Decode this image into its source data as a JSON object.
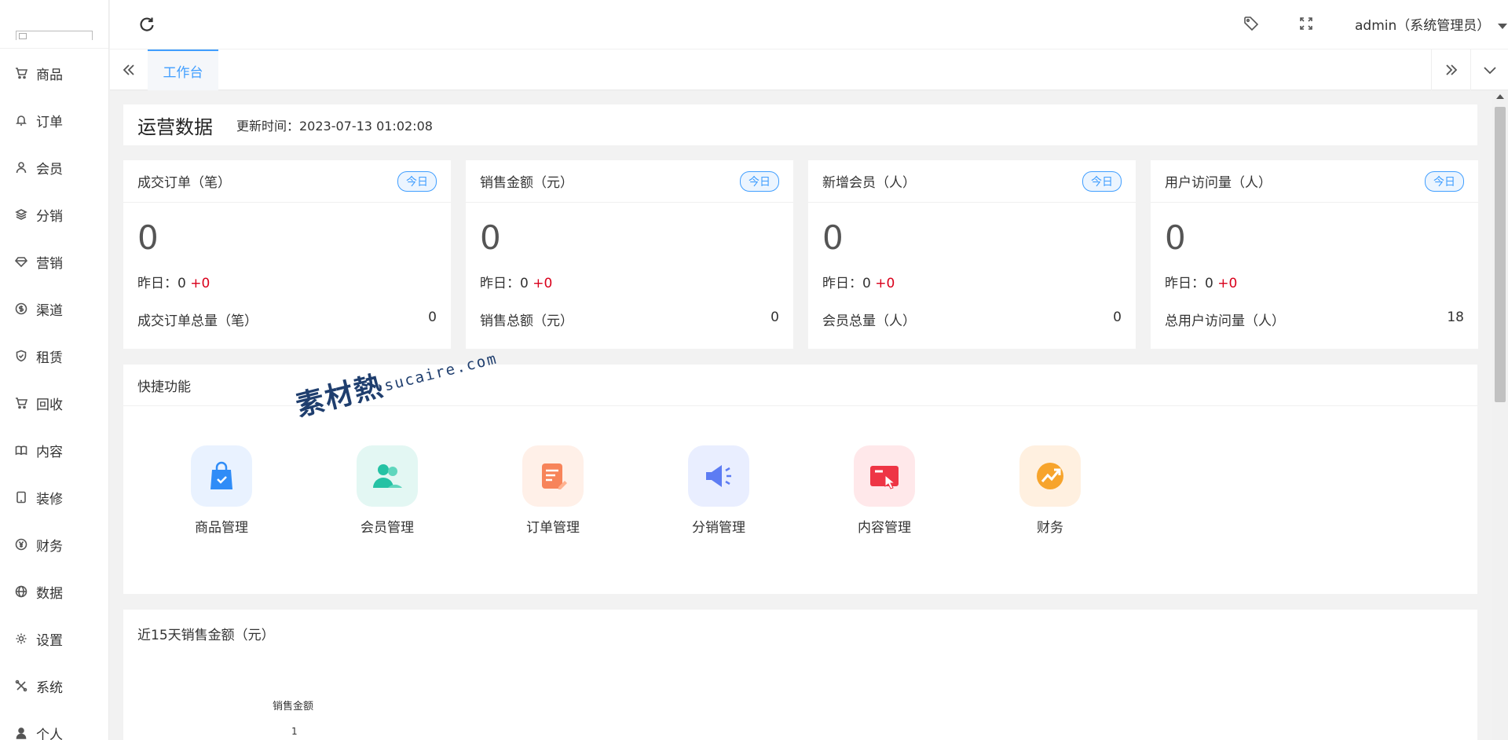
{
  "sidebar": {
    "items": [
      {
        "label": "商品",
        "icon": "cart-icon"
      },
      {
        "label": "订单",
        "icon": "bell-icon"
      },
      {
        "label": "会员",
        "icon": "user-icon"
      },
      {
        "label": "分销",
        "icon": "layers-icon"
      },
      {
        "label": "营销",
        "icon": "diamond-icon"
      },
      {
        "label": "渠道",
        "icon": "dollar-circle-icon"
      },
      {
        "label": "租赁",
        "icon": "shield-check-icon"
      },
      {
        "label": "回收",
        "icon": "cart-icon"
      },
      {
        "label": "内容",
        "icon": "book-open-icon"
      },
      {
        "label": "装修",
        "icon": "tablet-icon"
      },
      {
        "label": "财务",
        "icon": "yen-circle-icon"
      },
      {
        "label": "数据",
        "icon": "globe-icon"
      },
      {
        "label": "设置",
        "icon": "gear-icon"
      },
      {
        "label": "系统",
        "icon": "tools-icon"
      },
      {
        "label": "个人",
        "icon": "person-icon"
      }
    ]
  },
  "header": {
    "user": "admin（系统管理员）"
  },
  "tabs": {
    "active": "工作台"
  },
  "ops": {
    "title": "运营数据",
    "updated": "更新时间：2023-07-13 01:02:08"
  },
  "stats": [
    {
      "title": "成交订单（笔）",
      "badge": "今日",
      "value": "0",
      "yesterday_label": "昨日：0",
      "yesterday_delta": "+0",
      "total_label": "成交订单总量（笔）",
      "total_value": "0"
    },
    {
      "title": "销售金额（元）",
      "badge": "今日",
      "value": "0",
      "yesterday_label": "昨日：0",
      "yesterday_delta": "+0",
      "total_label": "销售总额（元）",
      "total_value": "0"
    },
    {
      "title": "新增会员（人）",
      "badge": "今日",
      "value": "0",
      "yesterday_label": "昨日：0",
      "yesterday_delta": "+0",
      "total_label": "会员总量（人）",
      "total_value": "0"
    },
    {
      "title": "用户访问量（人）",
      "badge": "今日",
      "value": "0",
      "yesterday_label": "昨日：0",
      "yesterday_delta": "+0",
      "total_label": "总用户访问量（人）",
      "total_value": "18"
    }
  ],
  "quick": {
    "title": "快捷功能",
    "items": [
      {
        "label": "商品管理",
        "icon": "shopping-bag-icon",
        "bg": "#e9f2ff",
        "color": "#2f8cf7"
      },
      {
        "label": "会员管理",
        "icon": "members-icon",
        "bg": "#e3f7f3",
        "color": "#25c2a4"
      },
      {
        "label": "订单管理",
        "icon": "order-note-icon",
        "bg": "#fff0e8",
        "color": "#f7845a"
      },
      {
        "label": "分销管理",
        "icon": "megaphone-icon",
        "bg": "#e9eeff",
        "color": "#5d7cf3"
      },
      {
        "label": "内容管理",
        "icon": "card-touch-icon",
        "bg": "#ffe8ea",
        "color": "#ee3545"
      },
      {
        "label": "财务",
        "icon": "trend-coin-icon",
        "bg": "#fff0e0",
        "color": "#f7a42c"
      }
    ]
  },
  "watermark": {
    "main": "素材熱",
    "sub": "sucaire.com"
  },
  "sales_chart": {
    "title": "近15天销售金额（元）",
    "legend": "销售金额",
    "tick": "1"
  }
}
